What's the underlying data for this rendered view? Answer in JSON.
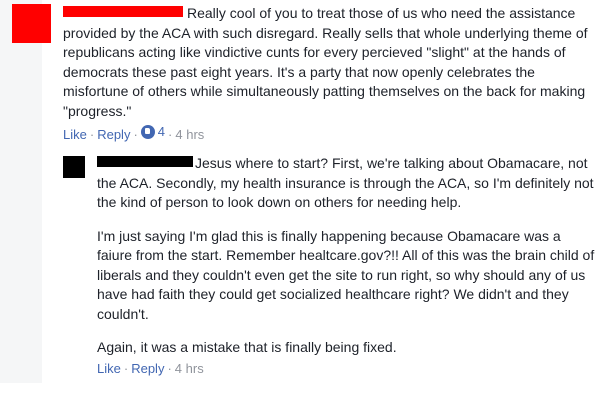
{
  "comment1": {
    "author_redacted": "",
    "text": "Really cool of you to treat those of us who need the assistance provided by the ACA with such disregard. Really sells that whole underlying theme of republicans acting like vindictive cunts for every percieved \"slight\" at the hands of democrats these past eight years. It's a party that now openly celebrates the misfortune of others while simultaneously patting themselves on the back for making \"progress.\"",
    "actions": {
      "like_label": "Like",
      "reply_label": "Reply",
      "reaction_count": "4",
      "timestamp": "4 hrs"
    }
  },
  "comment2": {
    "author_redacted": "",
    "paragraphs": [
      "Jesus where to start? First, we're talking about Obamacare, not the ACA. Secondly, my health insurance is through the ACA, so I'm definitely not the kind of person to look down on others for needing help.",
      "I'm just saying I'm glad this is finally happening because Obamacare was a faiure from the start. Remember healtcare.gov?!! All of this was the brain child of liberals and they couldn't even get the site to run right, so why should any of us have had faith they could get socialized healthcare right? We didn't and they couldn't.",
      "Again, it was a mistake that is finally being fixed."
    ],
    "actions": {
      "like_label": "Like",
      "reply_label": "Reply",
      "timestamp": "4 hrs"
    }
  },
  "colors": {
    "link": "#4267b2",
    "meta": "#90949c",
    "text": "#1d2129",
    "redaction_red": "#ff0000",
    "redaction_black": "#000000"
  }
}
